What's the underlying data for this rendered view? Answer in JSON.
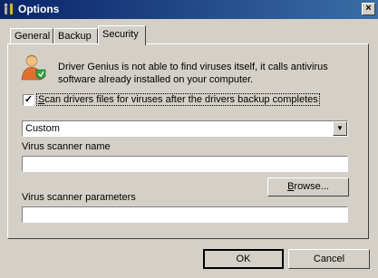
{
  "window": {
    "title": "Options",
    "close_glyph": "×"
  },
  "tabs": [
    {
      "label": "General",
      "active": false
    },
    {
      "label": "Backup",
      "active": false
    },
    {
      "label": "Security",
      "active": true
    }
  ],
  "security": {
    "info_text": "Driver Genius is not able to find viruses itself, it calls antivirus software already installed on your computer.",
    "scan_checkbox": {
      "checked": true,
      "check_glyph": "✓",
      "label_first": "S",
      "label_rest": "can drivers files for viruses after the drivers backup completes"
    },
    "scanner_select": {
      "value": "Custom",
      "arrow_glyph": "▼"
    },
    "scanner_name": {
      "label": "Virus scanner name",
      "value": ""
    },
    "browse_button": {
      "label_first": "B",
      "label_rest": "rowse..."
    },
    "scanner_params": {
      "label": "Virus scanner parameters",
      "value": ""
    }
  },
  "footer": {
    "ok_label": "OK",
    "cancel_label": "Cancel"
  },
  "icons": {
    "title_icon": "tools-icon",
    "info_icon": "user-shield-icon"
  },
  "colors": {
    "titlebar_start": "#0a246a",
    "titlebar_end": "#3a6ea5",
    "face": "#d4d0c8"
  }
}
